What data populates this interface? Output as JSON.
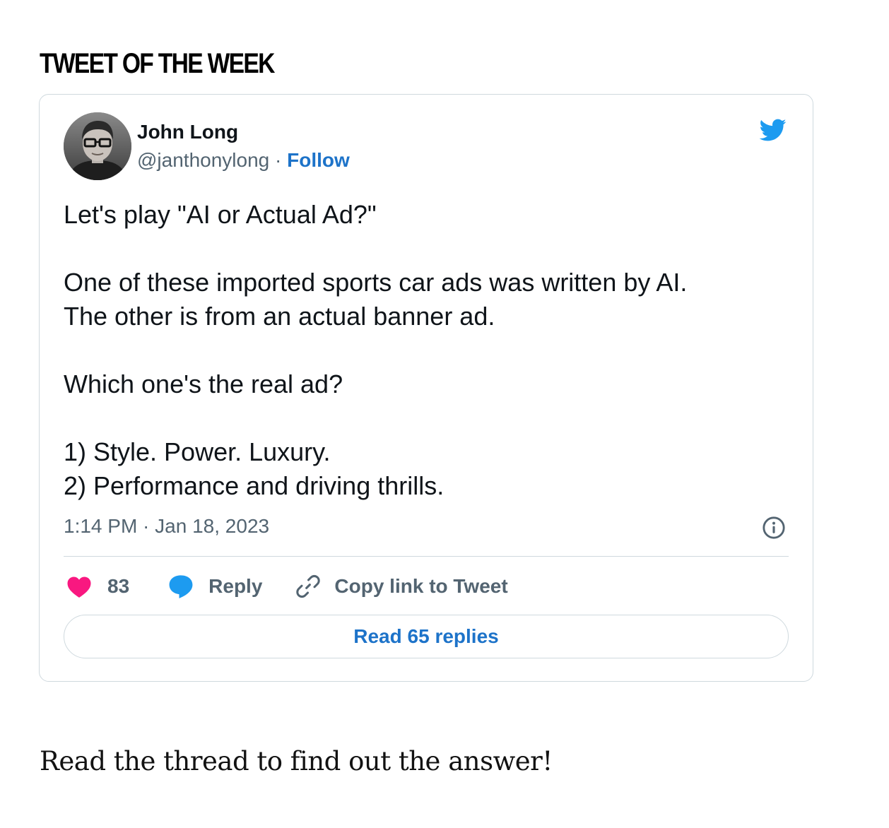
{
  "section": {
    "heading": "TWEET OF THE WEEK"
  },
  "tweet": {
    "author": {
      "name": "John Long",
      "handle": "@janthonylong",
      "separator": " · ",
      "follow_label": "Follow"
    },
    "text": {
      "line1": "Let's play \"AI or Actual Ad?\"",
      "line2": "One of these imported sports car ads was written by AI.",
      "line3": "The other is from an actual banner ad.",
      "line4": "Which one's the real ad?",
      "line5": "1) Style. Power. Luxury.",
      "line6": "2) Performance and driving thrills."
    },
    "meta": {
      "time": "1:14 PM",
      "separator": " · ",
      "date": "Jan 18, 2023"
    },
    "actions": {
      "like_count": "83",
      "reply_label": "Reply",
      "copy_label": "Copy link to Tweet"
    },
    "read_replies_label": "Read 65 replies"
  },
  "body": {
    "paragraph": "Read the thread to find out the answer!"
  },
  "icons": {
    "brand": "twitter-bird-icon",
    "like": "heart-icon",
    "reply": "speech-bubble-icon",
    "copy": "link-icon",
    "info": "info-icon"
  },
  "colors": {
    "twitter_blue": "#1d9bf0",
    "link_blue": "#1d73c9",
    "like_pink": "#f91880",
    "muted_text": "#536471",
    "border": "#cfd9de"
  }
}
